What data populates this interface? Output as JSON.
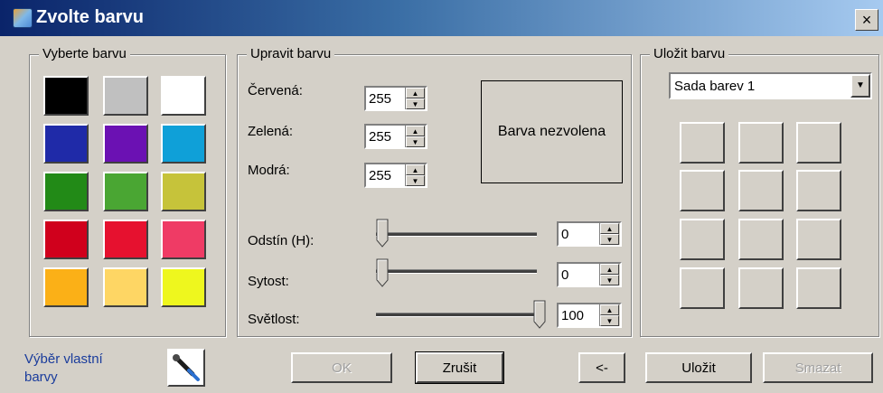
{
  "window": {
    "title": "Zvolte barvu",
    "close_label": "×",
    "icon": "color-picker-app-icon"
  },
  "choose": {
    "legend": "Vyberte barvu",
    "swatches": [
      [
        "#000000",
        "#c0c0c0",
        "#ffffff"
      ],
      [
        "#1f2aa8",
        "#6b11b3",
        "#0fa0d8"
      ],
      [
        "#228a17",
        "#4aa633",
        "#c6c33a"
      ],
      [
        "#d0001c",
        "#e6112f",
        "#ef3b65"
      ],
      [
        "#fbb017",
        "#fed664",
        "#eef71e"
      ]
    ],
    "custom_line1": "Výběr vlastní",
    "custom_line2": "barvy",
    "picker_icon": "eyedropper-icon"
  },
  "edit": {
    "legend": "Upravit barvu",
    "red_label": "Červená:",
    "red_value": "255",
    "green_label": "Zelená:",
    "green_value": "255",
    "blue_label": "Modrá:",
    "blue_value": "255",
    "preview_text": "Barva nezvolena",
    "hue_label": "Odstín (H):",
    "hue_value": "0",
    "sat_label": "Sytost:",
    "sat_value": "0",
    "light_label": "Světlost:",
    "light_value": "100",
    "sliders": {
      "hue": {
        "min": 0,
        "max": 360,
        "value": 0
      },
      "saturation": {
        "min": 0,
        "max": 100,
        "value": 0
      },
      "lightness": {
        "min": 0,
        "max": 100,
        "value": 100
      }
    }
  },
  "buttons": {
    "ok": "OK",
    "cancel": "Zrušit",
    "back": "<-",
    "save": "Uložit",
    "delete": "Smazat"
  },
  "save": {
    "legend": "Uložit barvu",
    "palette_selected": "Sada barev 1"
  },
  "colors": {
    "titlebar_start": "#0a246a",
    "titlebar_end": "#a6caf0",
    "face": "#d4d0c8",
    "link": "#1a3c9c"
  }
}
